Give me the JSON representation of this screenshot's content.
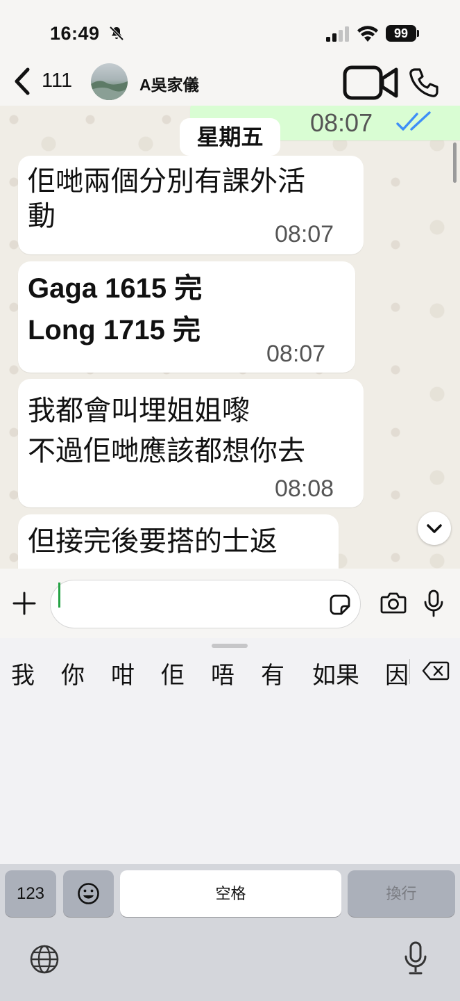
{
  "status_bar": {
    "time": "16:49",
    "battery": "99"
  },
  "header": {
    "unread_count": "111",
    "contact_name": "A吳家儀"
  },
  "chat": {
    "prev_message": {
      "time": "08:07"
    },
    "day_label": "星期五",
    "messages": [
      {
        "lines": [
          "佢哋兩個分別有課外活",
          "動"
        ],
        "time": "08:07"
      },
      {
        "lines": [
          "Gaga 1615 完",
          "Long 1715 完"
        ],
        "time": "08:07"
      },
      {
        "lines": [
          "我都會叫埋姐姐嚟",
          "不過佢哋應該都想你去"
        ],
        "time": "08:08"
      },
      {
        "lines": [
          "但接完後要搭的士返"
        ]
      }
    ]
  },
  "composer": {
    "value": ""
  },
  "keyboard": {
    "candidates": [
      "我",
      "你",
      "咁",
      "佢",
      "唔",
      "有",
      "如果",
      "因"
    ],
    "key_123": "123",
    "space_label": "空格",
    "return_label": "換行"
  },
  "colors": {
    "outgoing_bubble": "#d9fdd3",
    "incoming_bubble": "#ffffff",
    "read_ticks": "#3e8ef7",
    "cursor": "#25a244"
  }
}
